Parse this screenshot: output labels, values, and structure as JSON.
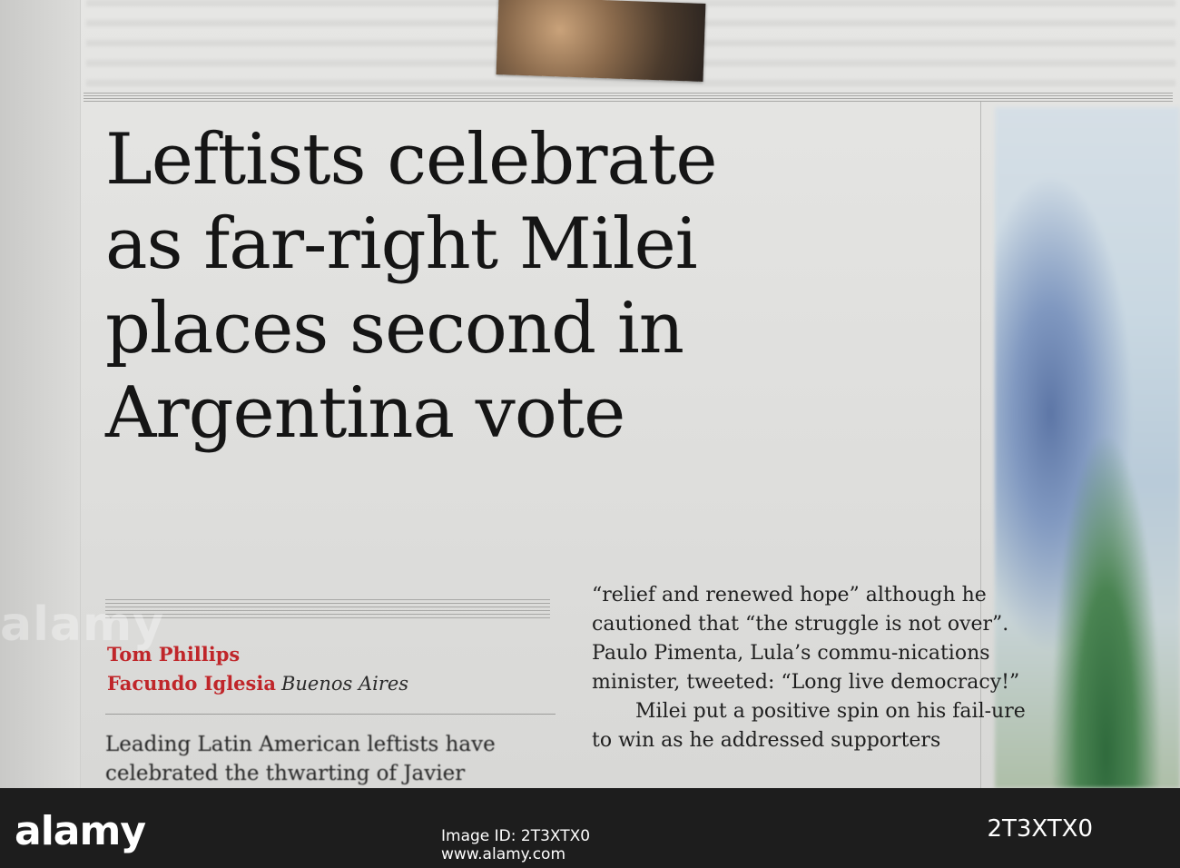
{
  "article": {
    "headline": "Leftists celebrate\nas far-right Milei\nplaces second in\nArgentina vote",
    "authors": [
      "Tom Phillips",
      "Facundo Iglesia"
    ],
    "location": "Buenos Aires",
    "body_left": "Leading Latin American leftists have celebrated the thwarting of Javier",
    "body_right_p1": "“relief and renewed hope” although he cautioned that “the struggle is not over”. Paulo Pimenta, Lula’s commu-nications minister, tweeted: “Long live democracy!”",
    "body_right_p2": "Milei put a positive spin on his fail-ure to win as he addressed supporters"
  },
  "watermark": "alamy",
  "banner": {
    "logo": "alamy",
    "image_id_prefix": "Image ID: 2T3XTX0",
    "url": "www.alamy.com",
    "image_id": "2T3XTX0"
  },
  "colors": {
    "byline_red": "#c0262a",
    "headline_ink": "#151515",
    "banner_bg": "#1d1d1d"
  }
}
